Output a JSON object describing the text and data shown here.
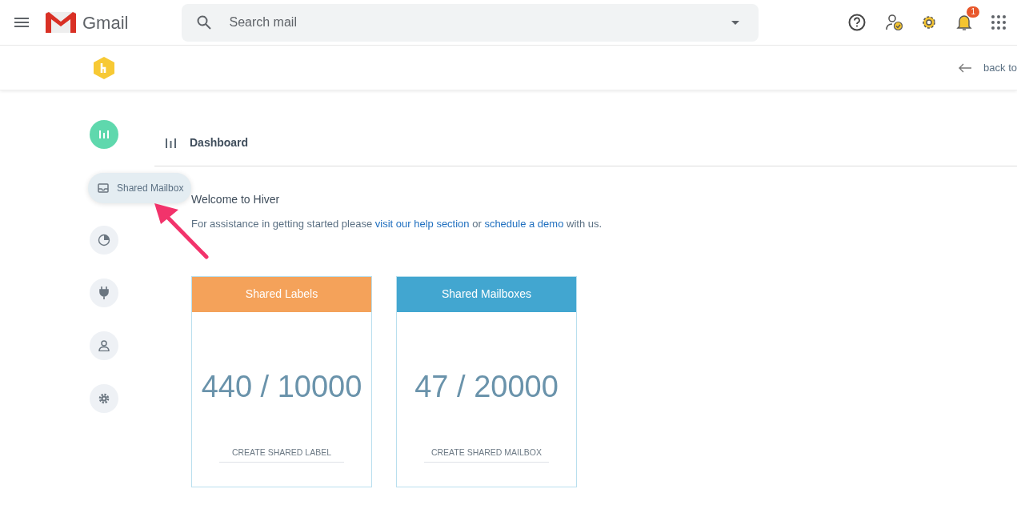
{
  "gmail_header": {
    "app_name": "Gmail",
    "search": {
      "placeholder": "Search mail"
    },
    "notification_count": "1"
  },
  "hiver_bar": {
    "back_link": "back to"
  },
  "sidebar": {
    "items": [
      {
        "selected": true
      },
      {
        "selected": false,
        "label": "Shared Mailbox"
      },
      {
        "selected": false
      },
      {
        "selected": false
      },
      {
        "selected": false
      },
      {
        "selected": false
      }
    ]
  },
  "page_title": "Dashboard",
  "welcome": "Welcome to Hiver",
  "assistance": {
    "before": "For assistance in getting started please",
    "link_1": "visit our help section",
    "middle": "or",
    "link_2": "schedule a demo",
    "after": "with us."
  },
  "cards": [
    {
      "title": "Shared Labels",
      "color": "#f4a25a",
      "count": "440 / 10000",
      "action": "CREATE SHARED LABEL"
    },
    {
      "title": "Shared Mailboxes",
      "color": "#42a6d0",
      "count": "47 / 20000",
      "action": "CREATE SHARED MAILBOX"
    }
  ]
}
